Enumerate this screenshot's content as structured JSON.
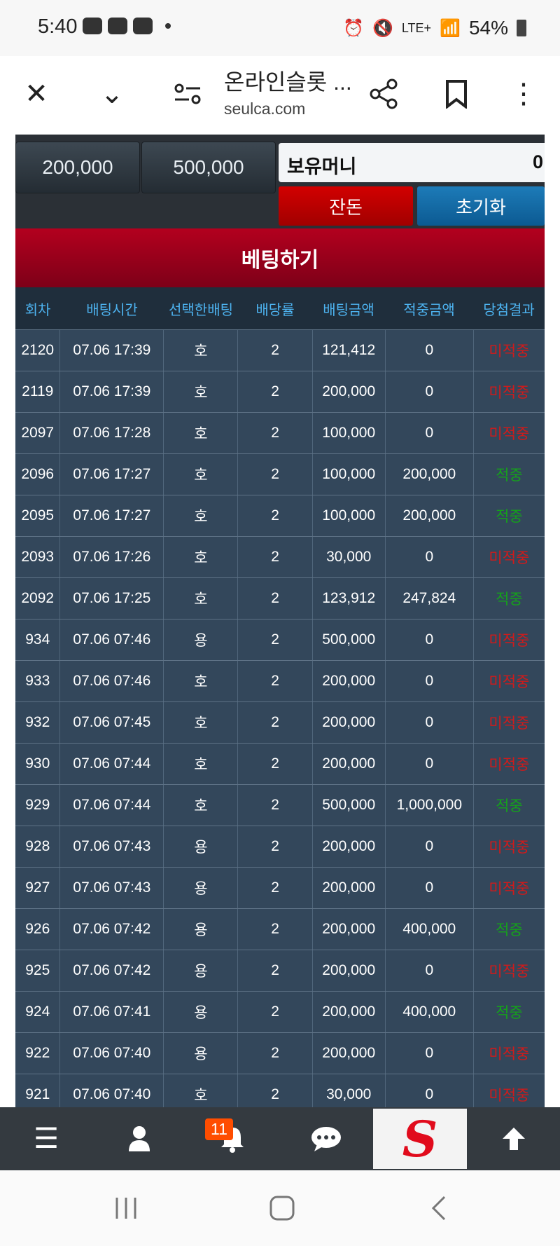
{
  "status_bar": {
    "time": "5:40",
    "network": "LTE+",
    "battery": "54%"
  },
  "browser": {
    "title": "온라인슬롯 ...",
    "url": "seulca.com"
  },
  "controls": {
    "amount_buttons": [
      "200,000",
      "500,000"
    ],
    "balance_label": "보유머니",
    "balance_value": "0",
    "red_button": "잔돈",
    "blue_button": "초기화"
  },
  "bet_header": "베팅하기",
  "table": {
    "headers": [
      "회차",
      "배팅시간",
      "선택한배팅",
      "배당률",
      "배팅금액",
      "적중금액",
      "당첨결과"
    ],
    "rows": [
      [
        "2120",
        "07.06 17:39",
        "호",
        "2",
        "121,412",
        "0",
        "미적중"
      ],
      [
        "2119",
        "07.06 17:39",
        "호",
        "2",
        "200,000",
        "0",
        "미적중"
      ],
      [
        "2097",
        "07.06 17:28",
        "호",
        "2",
        "100,000",
        "0",
        "미적중"
      ],
      [
        "2096",
        "07.06 17:27",
        "호",
        "2",
        "100,000",
        "200,000",
        "적중"
      ],
      [
        "2095",
        "07.06 17:27",
        "호",
        "2",
        "100,000",
        "200,000",
        "적중"
      ],
      [
        "2093",
        "07.06 17:26",
        "호",
        "2",
        "30,000",
        "0",
        "미적중"
      ],
      [
        "2092",
        "07.06 17:25",
        "호",
        "2",
        "123,912",
        "247,824",
        "적중"
      ],
      [
        "934",
        "07.06 07:46",
        "용",
        "2",
        "500,000",
        "0",
        "미적중"
      ],
      [
        "933",
        "07.06 07:46",
        "호",
        "2",
        "200,000",
        "0",
        "미적중"
      ],
      [
        "932",
        "07.06 07:45",
        "호",
        "2",
        "200,000",
        "0",
        "미적중"
      ],
      [
        "930",
        "07.06 07:44",
        "호",
        "2",
        "200,000",
        "0",
        "미적중"
      ],
      [
        "929",
        "07.06 07:44",
        "호",
        "2",
        "500,000",
        "1,000,000",
        "적중"
      ],
      [
        "928",
        "07.06 07:43",
        "용",
        "2",
        "200,000",
        "0",
        "미적중"
      ],
      [
        "927",
        "07.06 07:43",
        "용",
        "2",
        "200,000",
        "0",
        "미적중"
      ],
      [
        "926",
        "07.06 07:42",
        "용",
        "2",
        "200,000",
        "400,000",
        "적중"
      ],
      [
        "925",
        "07.06 07:42",
        "용",
        "2",
        "200,000",
        "0",
        "미적중"
      ],
      [
        "924",
        "07.06 07:41",
        "용",
        "2",
        "200,000",
        "400,000",
        "적중"
      ],
      [
        "922",
        "07.06 07:40",
        "용",
        "2",
        "200,000",
        "0",
        "미적중"
      ],
      [
        "921",
        "07.06 07:40",
        "호",
        "2",
        "30,000",
        "0",
        "미적중"
      ]
    ]
  },
  "bottom_nav": {
    "badge_count": "11",
    "logo": "S"
  },
  "colors": {
    "win": "#15a11b",
    "lose": "#d11a1a",
    "header_red": "#b3001e",
    "accent_blue": "#4db3f0"
  }
}
